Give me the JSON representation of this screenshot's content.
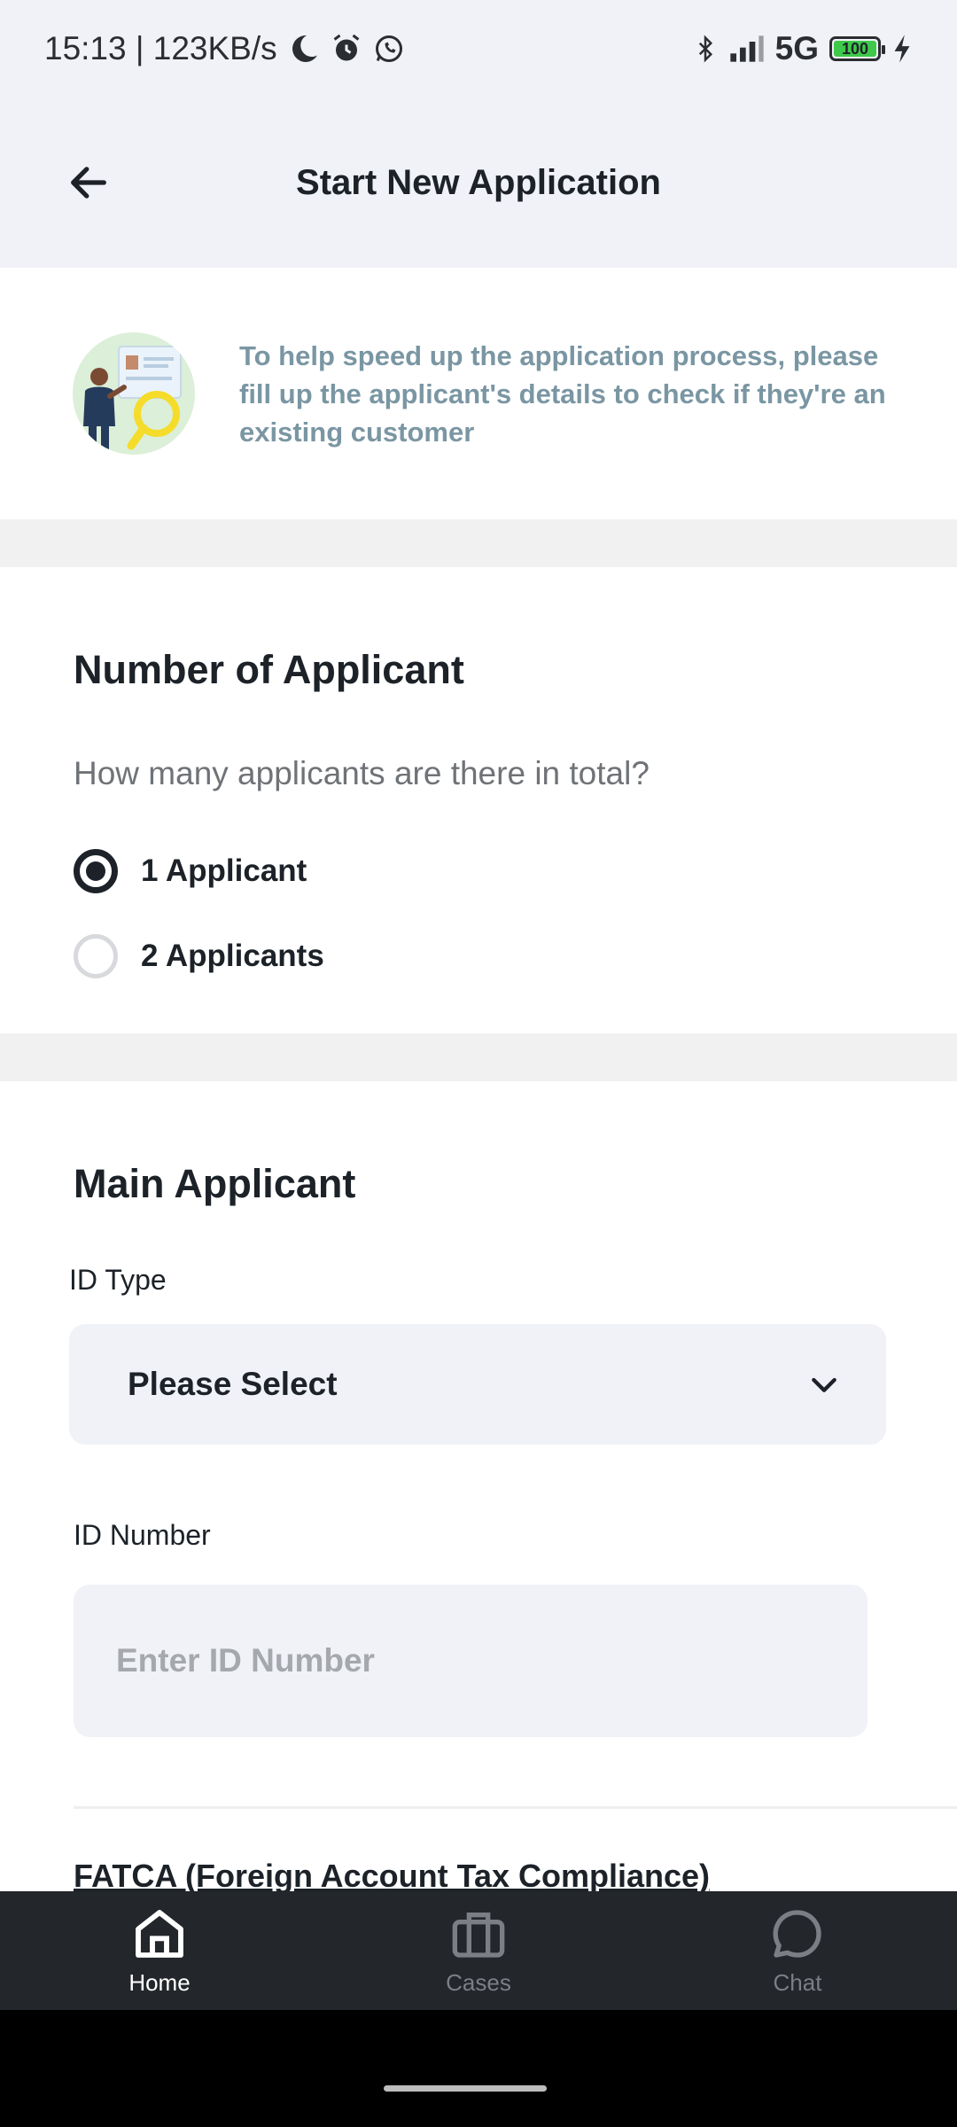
{
  "status_bar": {
    "time_speed": "15:13 | 123KB/s",
    "network": "5G",
    "battery": "100"
  },
  "header": {
    "title": "Start New Application"
  },
  "banner": {
    "text": "To help speed up the application process, please fill up the applicant's details to check if they're an existing customer"
  },
  "applicants_section": {
    "title": "Number of Applicant",
    "question": "How many applicants are there in total?",
    "options": [
      {
        "label": "1 Applicant",
        "selected": true
      },
      {
        "label": "2 Applicants",
        "selected": false
      }
    ]
  },
  "main_applicant": {
    "title": "Main Applicant",
    "id_type_label": "ID Type",
    "id_type_value": "Please Select",
    "id_number_label": "ID Number",
    "id_number_placeholder": "Enter ID Number",
    "id_number_value": ""
  },
  "fatca": {
    "title": "FATCA (Foreign Account Tax Compliance)"
  },
  "bottom_nav": {
    "items": [
      {
        "label": "Home",
        "icon": "home-icon",
        "active": true
      },
      {
        "label": "Cases",
        "icon": "briefcase-icon",
        "active": false
      },
      {
        "label": "Chat",
        "icon": "chat-bubble-icon",
        "active": false
      }
    ]
  },
  "colors": {
    "accent": "#f6d21a",
    "banner_text": "#7a96a3",
    "nav_bg": "#23262a"
  }
}
